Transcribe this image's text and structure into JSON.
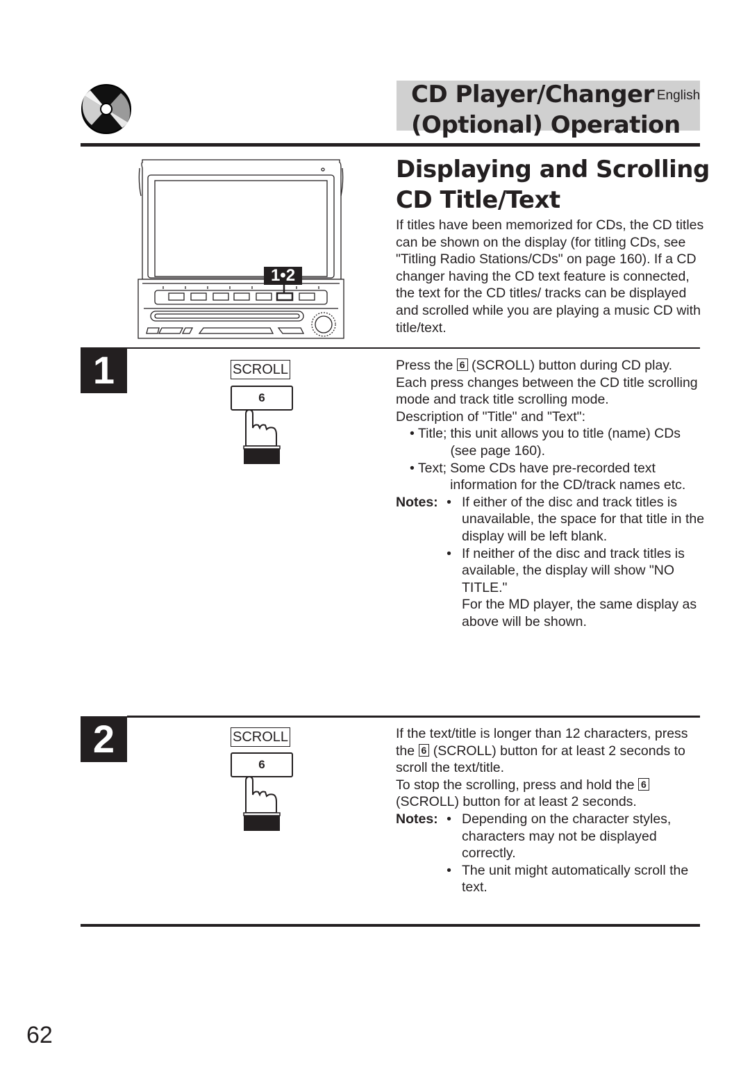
{
  "header": {
    "section_title_line1": "CD Player/Changer",
    "language": "English",
    "section_title_line2": "(Optional) Operation",
    "icon": "cd-disc-icon",
    "band_color": "#d0d0d0"
  },
  "page": {
    "heading_line1": "Displaying and Scrolling",
    "heading_line2": "CD Title/Text",
    "intro": "If titles have been memorized for CDs, the CD titles can be shown on the display (for titling CDs, see \"Titling Radio Stations/CDs\" on page 160). If a CD changer having the CD text feature is connected, the text for the CD titles/ tracks can be displayed and scrolled while you are playing a music CD with title/text.",
    "page_number": "62"
  },
  "device": {
    "callout_label": "1•2",
    "icon": "head-unit-illustration"
  },
  "steps": [
    {
      "number": "1",
      "scroll_label": "SCROLL",
      "key_label": "6",
      "text_before_key": "Press the",
      "key_inline": "6",
      "text_after_key": "(SCROLL) button during CD play. Each press changes between the CD title scrolling mode and track title scrolling mode.",
      "description_heading": "Description of \"Title\" and \"Text\":",
      "descriptions": [
        {
          "lead": "• Title;",
          "text": "this unit allows you to title (name) CDs (see page 160)."
        },
        {
          "lead": "• Text;",
          "text": "Some CDs have pre-recorded text information for the CD/track names etc."
        }
      ],
      "notes_label": "Notes:",
      "notes": [
        "If either of the disc and track titles is unavailable, the space for that title in the display will be left blank.",
        "If neither of the disc and track titles is available, the display will show \"NO TITLE.\""
      ],
      "notes_extra": "For the MD player, the same display as above will be shown."
    },
    {
      "number": "2",
      "scroll_label": "SCROLL",
      "key_label": "6",
      "para1_before": "If the text/title is longer than 12 characters, press the",
      "para1_key": "6",
      "para1_after": "(SCROLL) button for at least 2 seconds to scroll the text/title.",
      "para2_before": "To stop the scrolling, press and hold the",
      "para2_key": "6",
      "para2_after": "(SCROLL) button for at least 2 seconds.",
      "notes_label": "Notes:",
      "notes": [
        "Depending on the character styles, characters may not be displayed correctly.",
        "The unit might automatically scroll the text."
      ]
    }
  ]
}
